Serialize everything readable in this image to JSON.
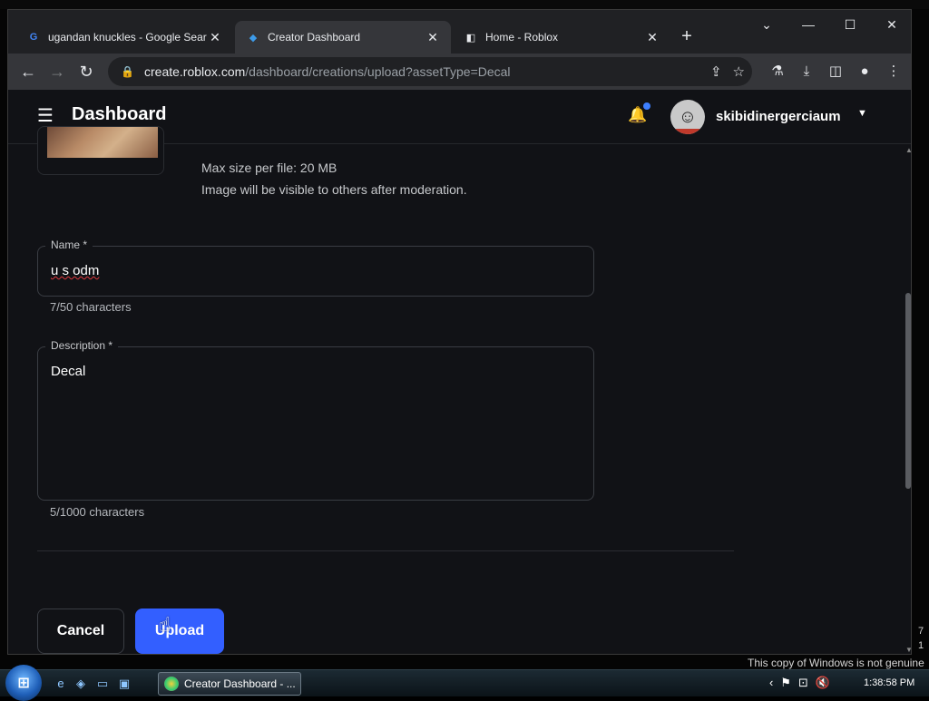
{
  "browser": {
    "tabs": [
      {
        "title": "ugandan knuckles - Google Sear",
        "favicon": "google-icon",
        "active": false
      },
      {
        "title": "Creator Dashboard",
        "favicon": "roblox-studio-icon",
        "active": true
      },
      {
        "title": "Home - Roblox",
        "favicon": "roblox-icon",
        "active": false
      }
    ],
    "new_tab": "+",
    "url_host": "create.roblox.com",
    "url_path": "/dashboard/creations/upload?assetType=Decal"
  },
  "header": {
    "title": "Dashboard",
    "username": "skibidinergerciaum"
  },
  "upload": {
    "info": [
      "Max size per file: 20 MB",
      "Image will be visible to others after moderation."
    ],
    "name_label": "Name *",
    "name_value": "u s odm",
    "name_counter": "7/50 characters",
    "description_label": "Description *",
    "description_value": "Decal",
    "description_counter": "5/1000 characters",
    "cancel_label": "Cancel",
    "upload_label": "Upload"
  },
  "taskbar": {
    "active_window": "Creator Dashboard - ...",
    "clock": "1:38:58 PM"
  },
  "watermark": "This copy of Windows is not genuine",
  "edge_digits": [
    "7",
    "1"
  ],
  "colors": {
    "accent": "#335fff",
    "page_bg": "#111216",
    "notification_dot": "#3d7fff"
  }
}
